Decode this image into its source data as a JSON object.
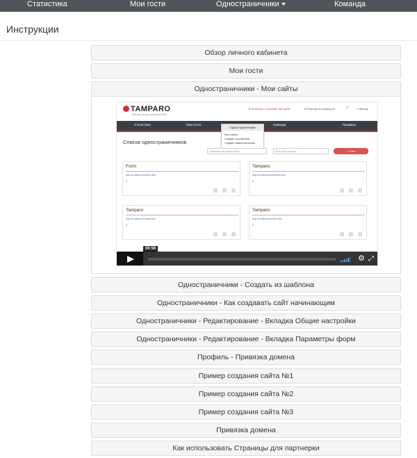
{
  "topnav": {
    "items": [
      "Статистика",
      "Мои гости",
      "Одностраничники",
      "Команда"
    ]
  },
  "page": {
    "title": "Инструкции"
  },
  "accordion": {
    "items_before": [
      "Обзор личного кабинета",
      "Мои гости"
    ],
    "open_item": "Одностраничники - Мои сайты",
    "items_after": [
      "Одностраничники - Создать из шаблона",
      "Одностраничники - Как создавать сайт начинающим",
      "Одностраничники - Редактирование - Вкладка Общие настройки",
      "Одностраничники - Редактирование - Вкладка Параметры форм",
      "Профиль - Привязка домена",
      "Пример создания сайта №1",
      "Пример создания сайта №2",
      "Пример создания сайта №3",
      "Привязка домена",
      "Как использовать Страницы для партнерки"
    ]
  },
  "video": {
    "brand": "TAMPARO",
    "tagline": "Всё для вашего успеха в МЛМ",
    "header_right": {
      "balance": "Осталось 1 установ. 981 дней",
      "help": "Помощь по сервису",
      "logout": "Выход"
    },
    "nav": [
      "Статистика",
      "Мои гости",
      "Одностраничники",
      "Команда",
      "Профиль"
    ],
    "dropdown": {
      "header": "Одностраничники",
      "items": [
        "Мои сайты",
        "Создать из шаблона",
        "Создать самостоятельно"
      ]
    },
    "list_title": "Список одностраничников",
    "filter_name_placeholder": "Название или домен сайта",
    "filter_category_placeholder": "Категория страниц",
    "create_button": "Сайт",
    "cards": [
      {
        "title": "Form",
        "url": "http://ru.dsbox.biz/form.html",
        "value": "0"
      },
      {
        "title": "Tamparo",
        "url": "http://ru.dsbox.biz/present.html",
        "value": "0"
      },
      {
        "title": "Tamparo",
        "url": "http://ru.dsbox.biz/start.html",
        "value": "0"
      },
      {
        "title": "Tamparo",
        "url": "http://ru.dsbox.biz/new.html",
        "value": "0"
      }
    ],
    "time": "00:56",
    "accent_color": "#d9534f"
  }
}
